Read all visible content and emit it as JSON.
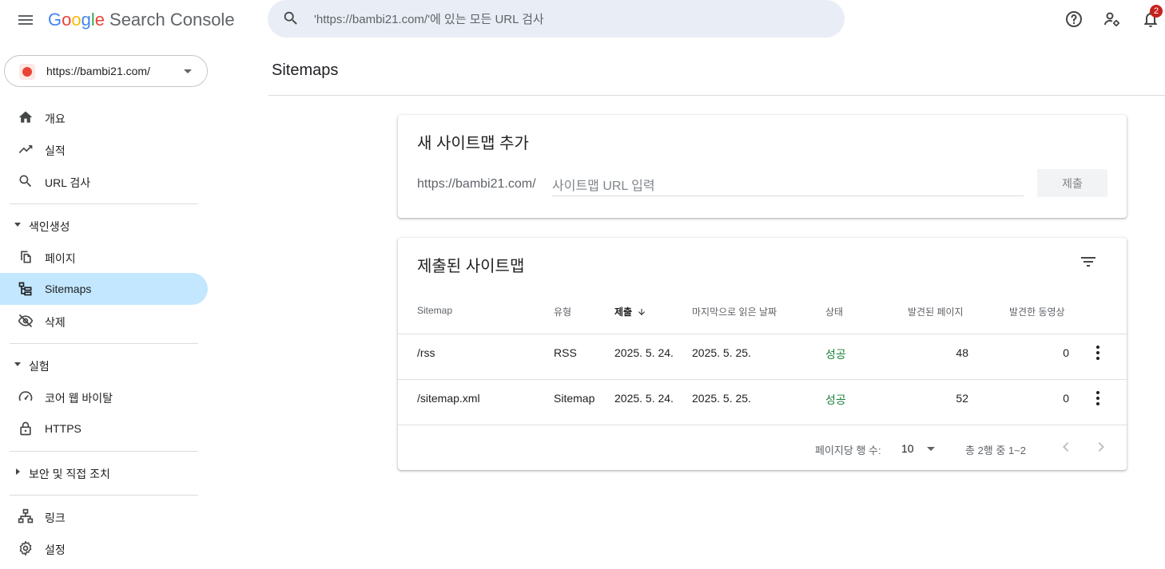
{
  "header": {
    "logo_letters": [
      "G",
      "o",
      "o",
      "g",
      "l",
      "e"
    ],
    "product": "Search Console",
    "search_placeholder": "'https://bambi21.com/'에 있는 모든 URL 검사",
    "notification_count": "2"
  },
  "property": {
    "label": "https://bambi21.com/"
  },
  "sidebar": {
    "items": [
      {
        "label": "개요",
        "icon": "home-icon"
      },
      {
        "label": "실적",
        "icon": "trending-up-icon"
      },
      {
        "label": "URL 검사",
        "icon": "search-icon"
      }
    ],
    "indexing": {
      "header": "색인생성",
      "items": [
        {
          "label": "페이지",
          "icon": "pages-icon"
        },
        {
          "label": "Sitemaps",
          "icon": "sitemap-icon",
          "active": true
        },
        {
          "label": "삭제",
          "icon": "visibility-off-icon"
        }
      ]
    },
    "experience": {
      "header": "실험",
      "items": [
        {
          "label": "코어 웹 바이탈",
          "icon": "speed-icon"
        },
        {
          "label": "HTTPS",
          "icon": "lock-icon"
        }
      ]
    },
    "security": {
      "header": "보안 및 직접 조치"
    },
    "bottom": [
      {
        "label": "링크",
        "icon": "links-icon"
      },
      {
        "label": "설정",
        "icon": "settings-icon"
      }
    ]
  },
  "main": {
    "title": "Sitemaps",
    "add_card": {
      "title": "새 사이트맵 추가",
      "prefix": "https://bambi21.com/",
      "input_placeholder": "사이트맵 URL 입력",
      "submit_label": "제출"
    },
    "submitted_card": {
      "title": "제출된 사이트맵",
      "columns": [
        "Sitemap",
        "유형",
        "제출",
        "마지막으로 읽은 날짜",
        "상태",
        "발견된 페이지",
        "발견한 동영상"
      ],
      "rows": [
        {
          "sitemap": "/rss",
          "type": "RSS",
          "submitted": "2025. 5. 24.",
          "last_read": "2025. 5. 25.",
          "status": "성공",
          "pages": "48",
          "videos": "0"
        },
        {
          "sitemap": "/sitemap.xml",
          "type": "Sitemap",
          "submitted": "2025. 5. 24.",
          "last_read": "2025. 5. 25.",
          "status": "성공",
          "pages": "52",
          "videos": "0"
        }
      ],
      "pager": {
        "rows_label": "페이지당 행 수:",
        "rows_value": "10",
        "range": "총 2행 중 1~2"
      }
    }
  },
  "colors": {
    "accent_active": "#c2e7ff",
    "success": "#188038",
    "badge": "#c5221f"
  }
}
